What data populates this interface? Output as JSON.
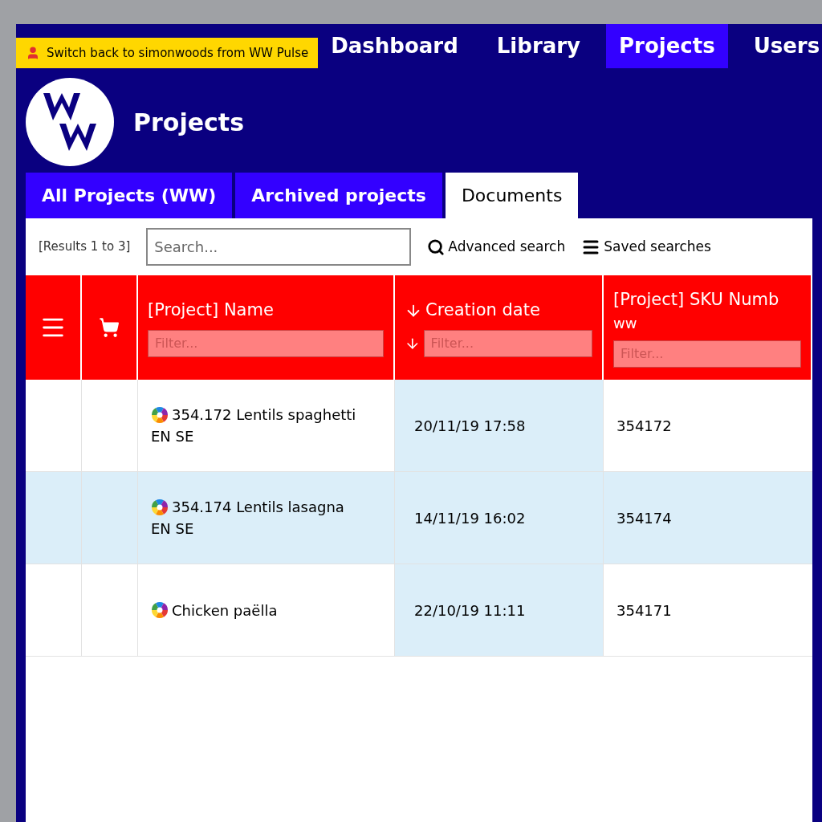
{
  "banner": {
    "text": "Switch back to simonwoods from WW Pulse"
  },
  "top_nav": [
    {
      "label": "Dashboard",
      "selected": false
    },
    {
      "label": "Library",
      "selected": false
    },
    {
      "label": "Projects",
      "selected": true
    },
    {
      "label": "Users",
      "selected": false
    }
  ],
  "section_title": "Projects",
  "tabs": [
    {
      "label": "All Projects (WW)",
      "selected": false
    },
    {
      "label": "Archived projects",
      "selected": false
    },
    {
      "label": "Documents",
      "selected": true
    }
  ],
  "toolbar": {
    "advanced_search": "Advanced search",
    "saved_searches": "Saved searches"
  },
  "search": {
    "placeholder": "Search..."
  },
  "results": "[Results 1 to 3]",
  "table": {
    "columns": [
      {
        "kind": "menu"
      },
      {
        "kind": "cart"
      },
      {
        "kind": "text",
        "label": "[Project] Name",
        "filter_placeholder": "Filter...",
        "sorted": false
      },
      {
        "kind": "text",
        "label": "Creation date",
        "filter_placeholder": "Filter...",
        "sorted": true
      },
      {
        "kind": "text",
        "label": "[Project] SKU Numb",
        "sublabel": "ww",
        "filter_placeholder": "Filter...",
        "sorted": false
      }
    ],
    "rows": [
      {
        "name": "354.172 Lentils spaghetti",
        "languages": "EN SE",
        "date": "20/11/19 17:58",
        "sku": "354172"
      },
      {
        "name": "354.174 Lentils lasagna",
        "languages": "EN SE",
        "date": "14/11/19 16:02",
        "sku": "354174"
      },
      {
        "name": "Chicken paëlla",
        "date": "22/10/19 11:11",
        "sku": "354171"
      }
    ]
  }
}
